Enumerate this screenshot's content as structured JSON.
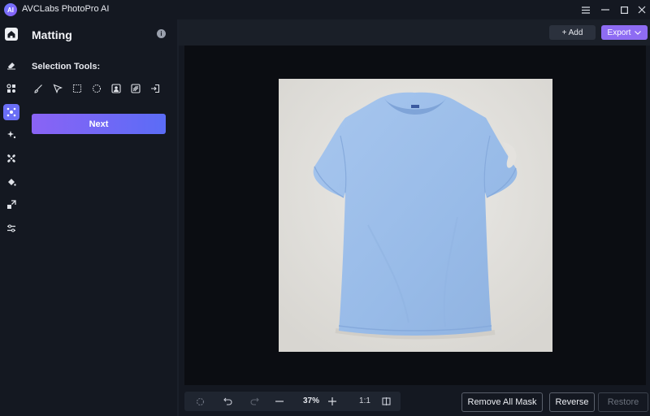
{
  "window": {
    "title": "AVCLabs PhotoPro AI",
    "logo_text": "AI"
  },
  "rail": {
    "items": [
      {
        "name": "home",
        "icon": "home-icon"
      },
      {
        "name": "eraser",
        "icon": "eraser-icon"
      },
      {
        "name": "objects",
        "icon": "objects-icon"
      },
      {
        "name": "matting",
        "icon": "matting-icon",
        "active": true
      },
      {
        "name": "enhance",
        "icon": "sparkle-icon"
      },
      {
        "name": "fan",
        "icon": "fan-icon"
      },
      {
        "name": "paint",
        "icon": "paint-bucket-icon"
      },
      {
        "name": "resize",
        "icon": "expand-icon"
      },
      {
        "name": "adjust",
        "icon": "sliders-icon"
      }
    ]
  },
  "panel": {
    "title": "Matting",
    "info_glyph": "i",
    "selection_label": "Selection Tools:",
    "tools": [
      "brush-icon",
      "cursor-icon",
      "rect-select-icon",
      "lasso-icon",
      "portrait-icon",
      "auto-select-icon",
      "import-icon"
    ],
    "next_label": "Next"
  },
  "topbar": {
    "add_label": "+ Add",
    "export_label": "Export"
  },
  "bottombar": {
    "zoom": "37%",
    "ratio": "1:1",
    "remove_all_label": "Remove All Mask",
    "reverse_label": "Reverse",
    "restore_label": "Restore"
  },
  "colors": {
    "accent": "#6a6ef5",
    "export": "#8e6cf3",
    "shirt": "#9bbde8",
    "background": "#141821"
  }
}
